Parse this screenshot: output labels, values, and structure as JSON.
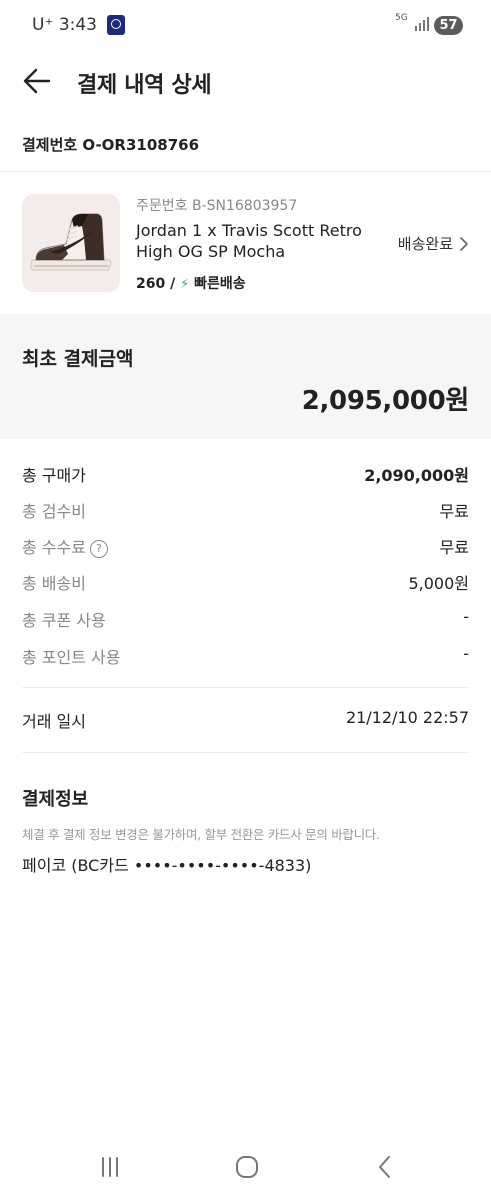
{
  "status_bar": {
    "carrier_time": "U⁺ 3:43",
    "network": "5G",
    "battery": "57"
  },
  "header": {
    "title": "결제 내역 상세"
  },
  "payment_number": "결제번호 O-OR3108766",
  "product": {
    "order_number": "주문번호 B-SN16803957",
    "name": "Jordan 1 x Travis Scott Retro High OG SP Mocha",
    "size": "260 /",
    "shipping": "빠른배송",
    "status": "배송완료"
  },
  "initial_payment": {
    "label": "최초 결제금액",
    "amount": "2,095,000원"
  },
  "breakdown": [
    {
      "label": "총 구매가",
      "value": "2,090,000원"
    },
    {
      "label": "총 검수비",
      "value": "무료"
    },
    {
      "label": "총 수수료",
      "value": "무료"
    },
    {
      "label": "총 배송비",
      "value": "5,000원"
    },
    {
      "label": "총 쿠폰 사용",
      "value": "-"
    },
    {
      "label": "총 포인트 사용",
      "value": "-"
    }
  ],
  "trade_date": {
    "label": "거래 일시",
    "value": "21/12/10 22:57"
  },
  "payment_info": {
    "title": "결제정보",
    "note": "체결 후 결제 정보 변경은 불가하며, 할부 전환은 카드사 문의 바랍니다.",
    "method": "페이코 (BC카드 ••••-••••-••••-4833)"
  },
  "colors": {
    "accent_green": "#31b46e",
    "summary_bg": "#f6f6f6"
  }
}
